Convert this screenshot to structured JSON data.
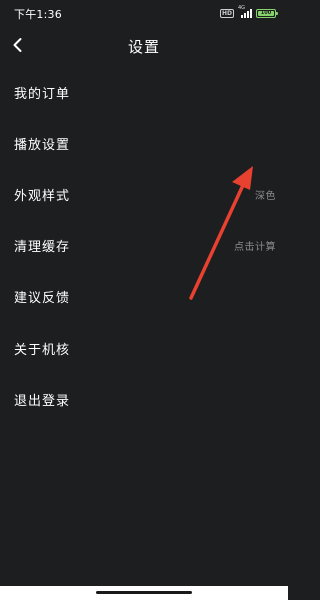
{
  "status_bar": {
    "time": "下午1:36",
    "hd_badge": "HD",
    "network": "4G",
    "battery": "100",
    "colors": {
      "battery": "#86d36b"
    }
  },
  "header": {
    "title": "设置",
    "back_icon": "chevron-left-icon"
  },
  "menu": {
    "items": [
      {
        "label": "我的订单",
        "value": ""
      },
      {
        "label": "播放设置",
        "value": ""
      },
      {
        "label": "外观样式",
        "value": "深色"
      },
      {
        "label": "清理缓存",
        "value": "点击计算"
      },
      {
        "label": "建议反馈",
        "value": ""
      },
      {
        "label": "关于机核",
        "value": ""
      },
      {
        "label": "退出登录",
        "value": ""
      }
    ]
  },
  "annotation": {
    "icon": "red-arrow-annotation",
    "color": "#e8412f"
  },
  "theme": {
    "background": "#1d1e20",
    "text": "#ffffff",
    "secondary_text": "#8d8d8d"
  }
}
